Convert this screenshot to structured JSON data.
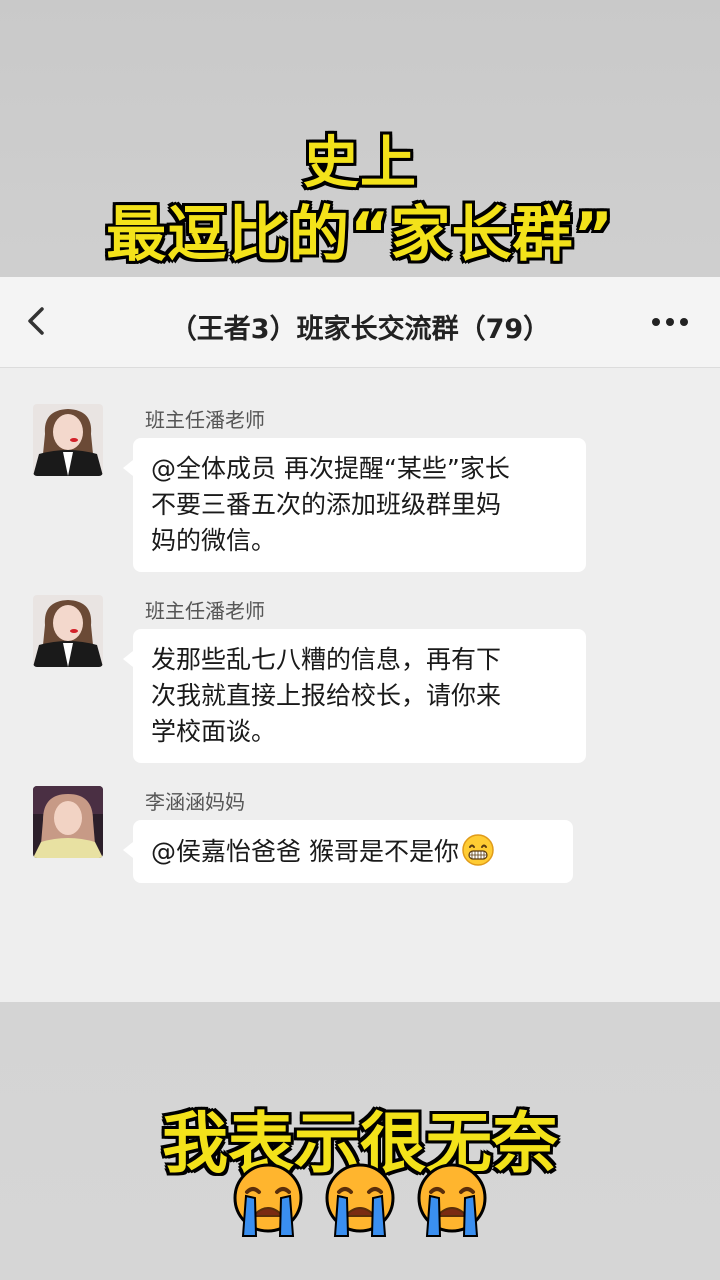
{
  "overlay": {
    "title_line1": "史上",
    "title_line2": "最逗比的“家长群”",
    "bottom_caption": "我表示很无奈",
    "bottom_emojis": [
      "loudly-crying-face-icon",
      "loudly-crying-face-icon",
      "loudly-crying-face-icon"
    ]
  },
  "nav": {
    "back_icon": "chevron-left-icon",
    "title": "（王者3）班家长交流群（79）",
    "more_icon": "more-dots-icon"
  },
  "messages": [
    {
      "sender": "班主任潘老师",
      "avatar": "teacher-avatar",
      "lines": [
        "@全体成员  再次提醒“某些”家长",
        "不要三番五次的添加班级群里妈",
        "妈的微信。"
      ]
    },
    {
      "sender": "班主任潘老师",
      "avatar": "teacher-avatar",
      "lines": [
        "发那些乱七八糟的信息，再有下",
        "次我就直接上报给校长，请你来",
        "学校面谈。"
      ]
    },
    {
      "sender": "李涵涵妈妈",
      "avatar": "parent-avatar",
      "lines": [
        "@侯嘉怡爸爸  猴哥是不是你"
      ],
      "trailing_emoji": "grinning-sweat-face-icon"
    }
  ],
  "colors": {
    "caption_yellow": "#f3e21a",
    "chat_background": "#eeeeee",
    "bubble_background": "#ffffff"
  }
}
